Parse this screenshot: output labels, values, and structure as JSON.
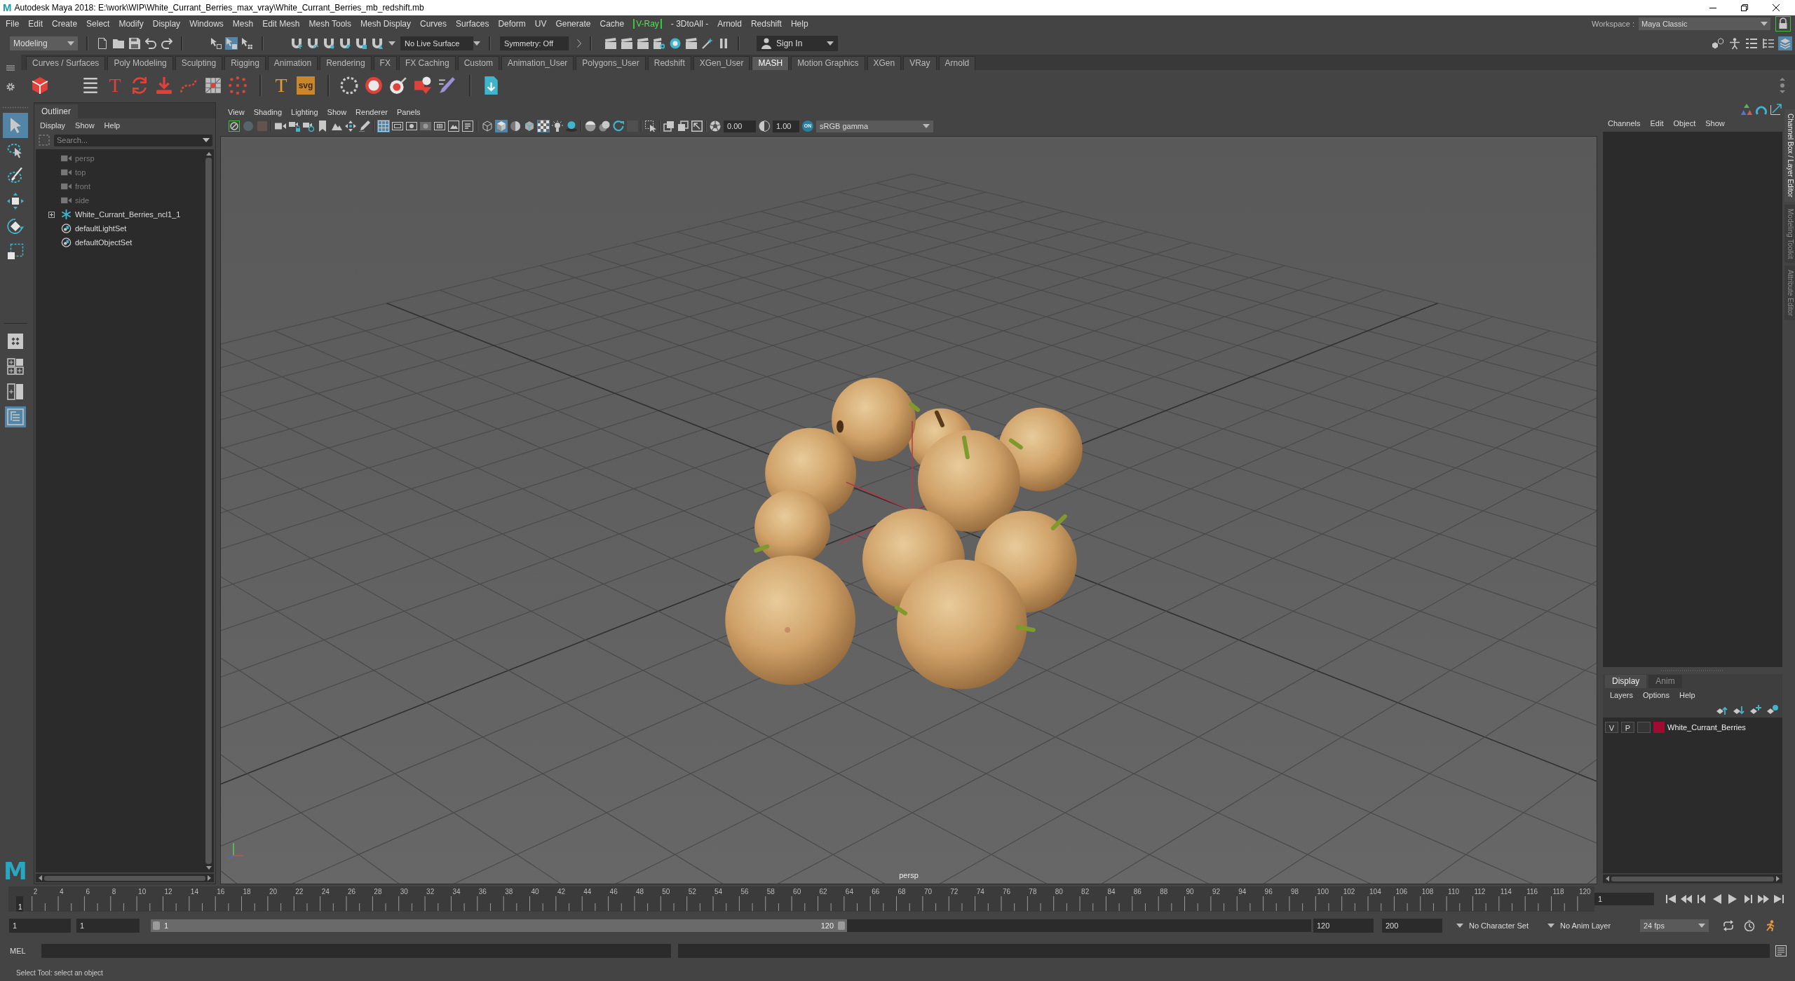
{
  "window": {
    "icon": "M",
    "title": "Autodesk Maya 2018: E:\\work\\WIP\\White_Currant_Berries_max_vray\\White_Currant_Berries_mb_redshift.mb"
  },
  "menu_bar": {
    "items": [
      {
        "label": "File",
        "highlighted": false
      },
      {
        "label": "Edit",
        "highlighted": false
      },
      {
        "label": "Create",
        "highlighted": false
      },
      {
        "label": "Select",
        "highlighted": false
      },
      {
        "label": "Modify",
        "highlighted": false
      },
      {
        "label": "Display",
        "highlighted": false
      },
      {
        "label": "Windows",
        "highlighted": false
      },
      {
        "label": "Mesh",
        "highlighted": false
      },
      {
        "label": "Edit Mesh",
        "highlighted": false
      },
      {
        "label": "Mesh Tools",
        "highlighted": false
      },
      {
        "label": "Mesh Display",
        "highlighted": false
      },
      {
        "label": "Curves",
        "highlighted": false
      },
      {
        "label": "Surfaces",
        "highlighted": false
      },
      {
        "label": "Deform",
        "highlighted": false
      },
      {
        "label": "UV",
        "highlighted": false
      },
      {
        "label": "Generate",
        "highlighted": false
      },
      {
        "label": "Cache",
        "highlighted": false
      },
      {
        "label": "V-Ray",
        "highlighted": true
      },
      {
        "label": "- 3DtoAll -",
        "highlighted": false
      },
      {
        "label": "Arnold",
        "highlighted": false
      },
      {
        "label": "Redshift",
        "highlighted": false
      },
      {
        "label": "Help",
        "highlighted": false
      }
    ],
    "workspace_label": "Workspace :",
    "workspace": "Maya Classic"
  },
  "status_line": {
    "mode": "Modeling",
    "select_modes": [
      {
        "selected": false
      },
      {
        "selected": true
      },
      {
        "selected": false
      }
    ],
    "live_surface": "No Live Surface",
    "symmetry": "Symmetry: Off",
    "sign_in": "Sign In",
    "panel_toggles": [
      {
        "on": false
      },
      {
        "on": false
      },
      {
        "on": false
      },
      {
        "on": false
      },
      {
        "on": true
      }
    ]
  },
  "shelf": {
    "tabs": [
      {
        "label": "Curves / Surfaces",
        "selected": false
      },
      {
        "label": "Poly Modeling",
        "selected": false
      },
      {
        "label": "Sculpting",
        "selected": false
      },
      {
        "label": "Rigging",
        "selected": false
      },
      {
        "label": "Animation",
        "selected": false
      },
      {
        "label": "Rendering",
        "selected": false
      },
      {
        "label": "FX",
        "selected": false
      },
      {
        "label": "FX Caching",
        "selected": false
      },
      {
        "label": "Custom",
        "selected": false
      },
      {
        "label": "Animation_User",
        "selected": false
      },
      {
        "label": "Polygons_User",
        "selected": false
      },
      {
        "label": "Redshift",
        "selected": false
      },
      {
        "label": "XGen_User",
        "selected": false
      },
      {
        "label": "MASH",
        "selected": true
      },
      {
        "label": "Motion Graphics",
        "selected": false
      },
      {
        "label": "XGen",
        "selected": false
      },
      {
        "label": "VRay",
        "selected": false
      },
      {
        "label": "Arnold",
        "selected": false
      }
    ],
    "mash_text_glyph": "T",
    "type_glyph": "T",
    "svg_glyph": "svg"
  },
  "toolbox": {
    "tools": [
      {
        "kind": "select",
        "selected": true
      },
      {
        "kind": "lasso",
        "selected": false
      },
      {
        "kind": "paint",
        "selected": false
      },
      {
        "kind": "move",
        "selected": false
      },
      {
        "kind": "rotate",
        "selected": false
      },
      {
        "kind": "scale",
        "selected": false
      }
    ],
    "layouts": [
      {
        "kind": "single",
        "selected": false
      },
      {
        "kind": "quad",
        "selected": false
      },
      {
        "kind": "split",
        "selected": false
      },
      {
        "kind": "outliner",
        "selected": true
      }
    ],
    "logo": "M"
  },
  "outliner": {
    "title": "Outliner",
    "menus": [
      "Display",
      "Show",
      "Help"
    ],
    "search": {
      "placeholder": "Search..."
    },
    "items": [
      {
        "label": "persp",
        "kind": "camera",
        "dimmed": true
      },
      {
        "label": "top",
        "kind": "camera",
        "dimmed": true
      },
      {
        "label": "front",
        "kind": "camera",
        "dimmed": true
      },
      {
        "label": "side",
        "kind": "camera",
        "dimmed": true
      },
      {
        "label": "White_Currant_Berries_ncl1_1",
        "kind": "group",
        "dimmed": false,
        "expanded": false
      },
      {
        "label": "defaultLightSet",
        "kind": "set",
        "dimmed": false
      },
      {
        "label": "defaultObjectSet",
        "kind": "set",
        "dimmed": false
      }
    ]
  },
  "viewport": {
    "menus": [
      "View",
      "Shading",
      "Lighting",
      "Show",
      "Renderer",
      "Panels"
    ],
    "grid_toggles": [
      {
        "on": true
      },
      {
        "on": false
      },
      {
        "on": false
      },
      {
        "on": false
      },
      {
        "on": false
      },
      {
        "on": false
      },
      {
        "on": false
      }
    ],
    "shading_toggles": [
      {
        "on": false
      },
      {
        "on": true
      },
      {
        "on": false
      },
      {
        "on": false
      },
      {
        "on": true
      },
      {
        "on": false
      },
      {
        "on": false
      }
    ],
    "exposure": "0.00",
    "gamma": "1.00",
    "color_management": "ON",
    "color_space": "sRGB gamma",
    "camera": "persp"
  },
  "right_panel": {
    "side_tabs": [
      {
        "label": "Channel Box / Layer Editor",
        "selected": true
      },
      {
        "label": "Modeling Toolkit",
        "selected": false
      },
      {
        "label": "Attribute Editor",
        "selected": false
      }
    ],
    "channel_box_menus": [
      "Channels",
      "Edit",
      "Object",
      "Show"
    ],
    "layer_editor": {
      "tabs": [
        {
          "label": "Display",
          "selected": true
        },
        {
          "label": "Anim",
          "selected": false
        }
      ],
      "menus": [
        "Layers",
        "Options",
        "Help"
      ],
      "layers": [
        {
          "visibility_toggle": "V",
          "playback_toggle": "P",
          "color": "#a00c2f",
          "name": "White_Currant_Berries"
        }
      ]
    }
  },
  "timeline": {
    "ticks": [
      "2",
      "4",
      "6",
      "8",
      "10",
      "12",
      "14",
      "16",
      "18",
      "20",
      "22",
      "24",
      "26",
      "28",
      "30",
      "32",
      "34",
      "36",
      "38",
      "40",
      "42",
      "44",
      "46",
      "48",
      "50",
      "52",
      "54",
      "56",
      "58",
      "60",
      "62",
      "64",
      "66",
      "68",
      "70",
      "72",
      "74",
      "76",
      "78",
      "80",
      "82",
      "84",
      "86",
      "88",
      "90",
      "92",
      "94",
      "96",
      "98",
      "100",
      "102",
      "104",
      "106",
      "108",
      "110",
      "112",
      "114",
      "116",
      "118",
      "120"
    ],
    "current_frame_marker": "1",
    "current_frame": "1"
  },
  "range_slider": {
    "start": "1",
    "playback_start": "1",
    "slider_start": "1",
    "slider_end": "120",
    "level": 0.6,
    "playback_end": "120",
    "end": "200",
    "character_set": "No Character Set",
    "anim_layer": "No Anim Layer",
    "fps": "24 fps"
  },
  "command_line": {
    "language": "MEL"
  },
  "help_line": "Select Tool: select an object"
}
